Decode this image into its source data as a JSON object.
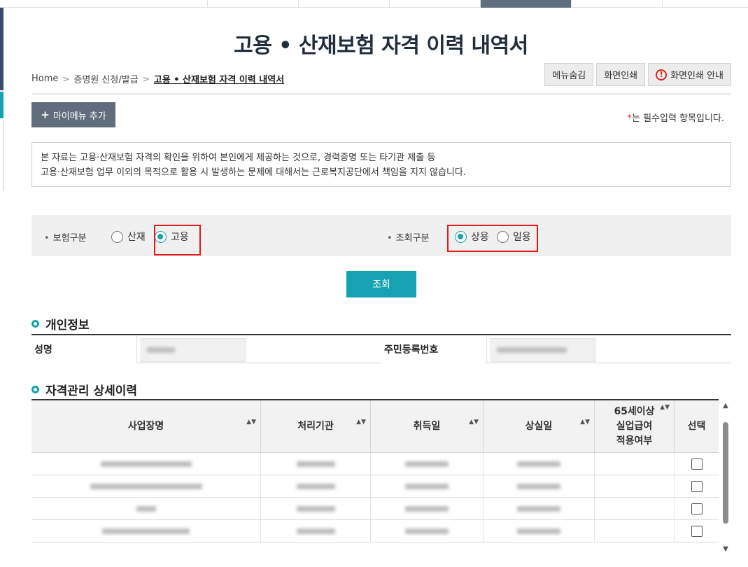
{
  "page": {
    "title": "고용 • 산재보험 자격 이력 내역서"
  },
  "breadcrumb": {
    "home": "Home",
    "level1": "증명원 신청/발급",
    "current": "고용 • 산재보험 자격 이력 내역서",
    "separator": ">"
  },
  "toolbar": {
    "hide_menu_label": "메뉴숨김",
    "print_label": "화면인쇄",
    "print_guide_label": "화면인쇄 안내",
    "print_guide_icon": "alert-circle-icon",
    "print_guide_icon_glyph": "!"
  },
  "mymenu": {
    "label": "마이메뉴 추가",
    "icon_glyph": "+"
  },
  "required_note": {
    "star": "*",
    "text": "는 필수입력 항목입니다."
  },
  "notice": {
    "line1": "본 자료는 고용·산재보험 자격의 확인을 위하여 본인에게 제공하는 것으로, 경력증명 또는 타기관 제출 등",
    "line2": "고용·산재보험 업무 이외의 목적으로 활용 시 발생하는 문제에 대해서는 근로복지공단에서 책임을 지지 않습니다."
  },
  "search": {
    "insurance_label": "보험구분",
    "insurance_options": [
      {
        "label": "산재",
        "checked": false
      },
      {
        "label": "고용",
        "checked": true
      }
    ],
    "query_label": "조회구분",
    "query_options": [
      {
        "label": "상용",
        "checked": true
      },
      {
        "label": "일용",
        "checked": false
      }
    ],
    "bullet": "•",
    "submit_label": "조회",
    "accent_color": "#17a2b1",
    "highlight_color": "#e11b1b"
  },
  "personal": {
    "section_title": "개인정보",
    "name_label": "성명",
    "rrn_label": "주민등록번호"
  },
  "history": {
    "section_title": "자격관리 상세이력",
    "columns": [
      {
        "label": "사업장명",
        "sortable": true
      },
      {
        "label": "처리기관",
        "sortable": true
      },
      {
        "label": "취득일",
        "sortable": true
      },
      {
        "label": "상실일",
        "sortable": true
      },
      {
        "label": "65세이상\n실업급여\n적용여부",
        "sortable": true
      },
      {
        "label": "선택",
        "sortable": false
      }
    ],
    "sort_glyph": "▲▼",
    "rows": [
      {
        "checked": false
      },
      {
        "checked": false
      },
      {
        "checked": false
      },
      {
        "checked": false
      }
    ]
  }
}
